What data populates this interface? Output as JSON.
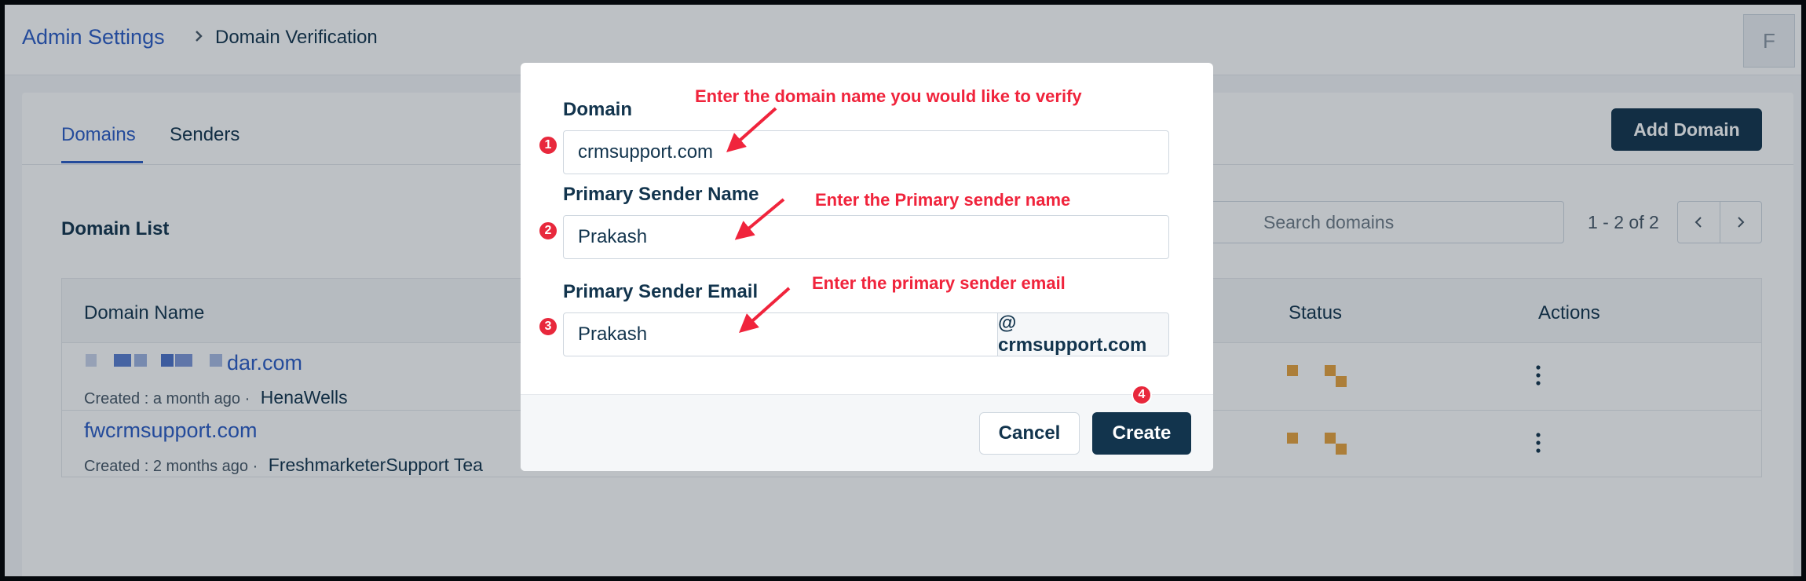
{
  "breadcrumb": {
    "root": "Admin Settings",
    "current": "Domain Verification"
  },
  "avatar": {
    "initial": "F"
  },
  "tabs": [
    {
      "label": "Domains",
      "active": true
    },
    {
      "label": "Senders",
      "active": false
    }
  ],
  "add_domain_label": "Add Domain",
  "domain_list": {
    "title": "Domain List",
    "search_placeholder": "Search domains",
    "pagination": "1 - 2 of 2",
    "columns": [
      "Domain Name",
      "Status",
      "Actions"
    ],
    "rows": [
      {
        "name": "dar.com",
        "created": "Created : a month ago",
        "by": "HenaWells"
      },
      {
        "name": "fwcrmsupport.com",
        "created": "Created : 2 months ago",
        "by": "FreshmarketerSupport Tea"
      }
    ]
  },
  "modal": {
    "domain_label": "Domain",
    "domain_value": "crmsupport.com",
    "sender_name_label": "Primary Sender Name",
    "sender_name_value": "Prakash",
    "sender_email_label": "Primary Sender Email",
    "sender_email_value": "Prakash",
    "email_suffix": "@ crmsupport.com",
    "cancel_label": "Cancel",
    "create_label": "Create"
  },
  "annotations": {
    "steps": [
      "1",
      "2",
      "3",
      "4"
    ],
    "notes": [
      "Enter the domain name you would like to verify",
      "Enter the Primary sender name",
      "Enter the primary sender email"
    ]
  },
  "colors": {
    "brand_blue": "#2c5cc5",
    "navy": "#12344d",
    "annotation_red": "#f0243c",
    "status_orange": "#e8a33d"
  }
}
